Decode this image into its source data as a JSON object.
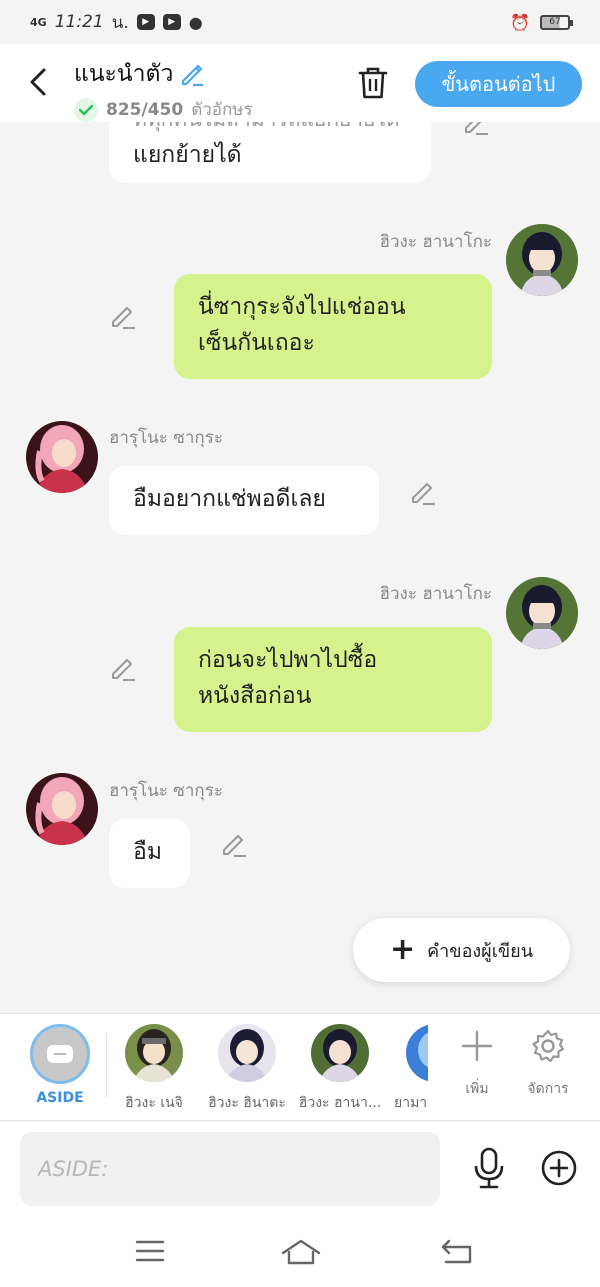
{
  "status_bar": {
    "network": "4G",
    "time": "11:21",
    "period": "น.",
    "battery": "67"
  },
  "header": {
    "title": "แนะนำตัว",
    "char_count": "825/450",
    "char_unit": "ตัวอักษร",
    "next_label": "ขั้นตอนต่อไป"
  },
  "messages": [
    {
      "side": "left",
      "speaker": "",
      "text_lines": [
        "ที่ทุกคนไม่สามารถแยกย้ายได้",
        "แยกย้ายได้"
      ]
    },
    {
      "side": "right",
      "speaker": "ฮิวงะ ฮานาโกะ",
      "text_lines": [
        "นี่ซากุระจังไปแช่ออน",
        "เซ็นกันเถอะ"
      ]
    },
    {
      "side": "left",
      "speaker": "ฮารุโนะ ซากุระ",
      "text_lines": [
        "อืมอยากแช่พอดีเลย"
      ]
    },
    {
      "side": "right",
      "speaker": "ฮิวงะ ฮานาโกะ",
      "text_lines": [
        "ก่อนจะไปพาไปซื้อ",
        "หนังสือก่อน"
      ]
    },
    {
      "side": "left",
      "speaker": "ฮารุโนะ ซากุระ",
      "text_lines": [
        "อืม"
      ]
    }
  ],
  "fab": {
    "label": "คำของผู้เขียน"
  },
  "characters": {
    "aside_label": "ASIDE",
    "items": [
      {
        "name": "ฮิวงะ เนจิ"
      },
      {
        "name": "ฮิวงะ ฮินาตะ"
      },
      {
        "name": "ฮิวงะ ฮานา..."
      },
      {
        "name": "ยามา"
      }
    ],
    "add_label": "เพิ่ม",
    "manage_label": "จัดการ"
  },
  "input": {
    "placeholder": "ASIDE:"
  },
  "colors": {
    "accent": "#4aa8f0",
    "right_bubble": "#d6f28d",
    "left_bubble": "#ffffff",
    "background": "#f4f4f4"
  }
}
